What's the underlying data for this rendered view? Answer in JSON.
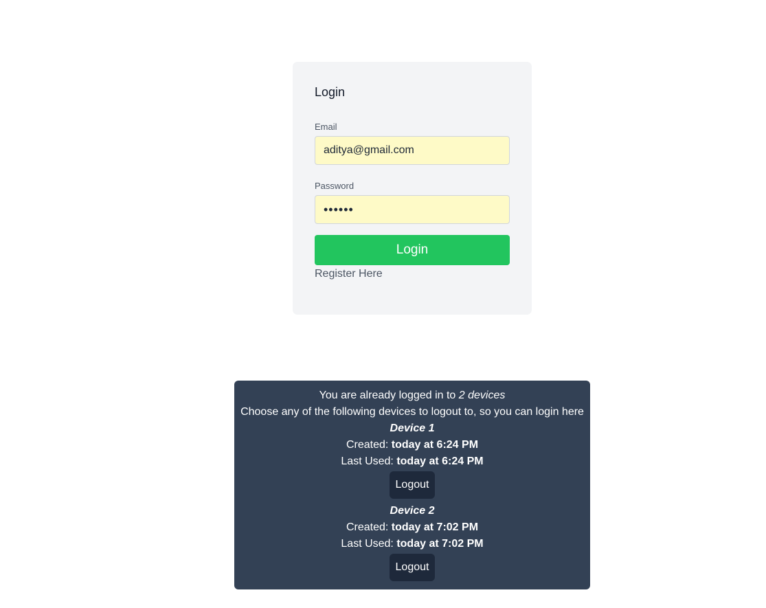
{
  "login": {
    "title": "Login",
    "email_label": "Email",
    "email_value": "aditya@gmail.com",
    "password_label": "Password",
    "password_value": "••••••",
    "submit_label": "Login",
    "register_label": "Register Here"
  },
  "devices_notice": {
    "intro_prefix": "You are already logged in to ",
    "intro_count": "2 devices",
    "instruction": "Choose any of the following devices to logout to, so you can login here",
    "created_label": "Created: ",
    "last_used_label": "Last Used: ",
    "devices": [
      {
        "name": "Device 1",
        "created": "today at 6:24 PM",
        "last_used": "today at 6:24 PM",
        "logout_label": "Logout"
      },
      {
        "name": "Device 2",
        "created": "today at 7:02 PM",
        "last_used": "today at 7:02 PM",
        "logout_label": "Logout"
      }
    ]
  },
  "colors": {
    "card_bg": "#f3f4f6",
    "input_autofill_bg": "#fefac7",
    "primary_button": "#22c55e",
    "panel_bg": "#334155",
    "logout_button_bg": "#1e293b"
  }
}
